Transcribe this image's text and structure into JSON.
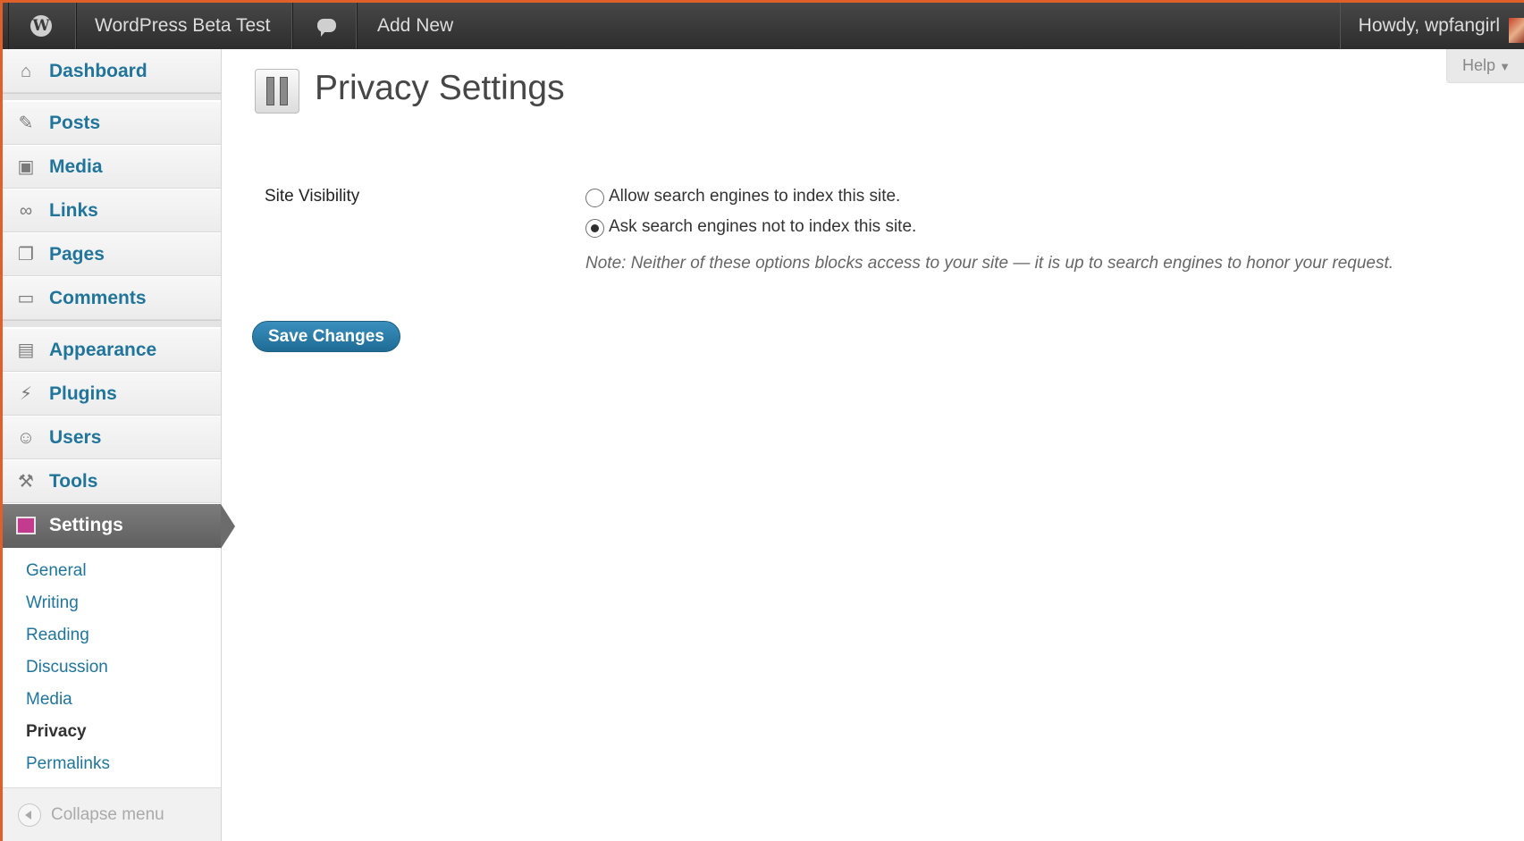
{
  "adminbar": {
    "site_name": "WordPress Beta Test",
    "add_new": "Add New",
    "howdy": "Howdy, wpfangirl"
  },
  "sidebar": {
    "items": [
      {
        "label": "Dashboard",
        "icon": "home-icon"
      },
      {
        "label": "Posts",
        "icon": "pin-icon"
      },
      {
        "label": "Media",
        "icon": "media-icon"
      },
      {
        "label": "Links",
        "icon": "link-icon"
      },
      {
        "label": "Pages",
        "icon": "pages-icon"
      },
      {
        "label": "Comments",
        "icon": "comment-icon"
      },
      {
        "label": "Appearance",
        "icon": "appearance-icon"
      },
      {
        "label": "Plugins",
        "icon": "plugin-icon"
      },
      {
        "label": "Users",
        "icon": "users-icon"
      },
      {
        "label": "Tools",
        "icon": "tools-icon"
      },
      {
        "label": "Settings",
        "icon": "settings-icon"
      }
    ],
    "submenu": [
      "General",
      "Writing",
      "Reading",
      "Discussion",
      "Media",
      "Privacy",
      "Permalinks"
    ],
    "active_submenu": "Privacy",
    "collapse": "Collapse menu"
  },
  "main": {
    "title": "Privacy Settings",
    "help": "Help",
    "field_label": "Site Visibility",
    "option_allow": "Allow search engines to index this site.",
    "option_block": "Ask search engines not to index this site.",
    "selected_option": "option_block",
    "note": "Note: Neither of these options blocks access to your site — it is up to search engines to honor your request.",
    "save_label": "Save Changes"
  },
  "colors": {
    "accent": "#21759b",
    "adminbar": "#333333",
    "frame_border": "#e0602a"
  }
}
